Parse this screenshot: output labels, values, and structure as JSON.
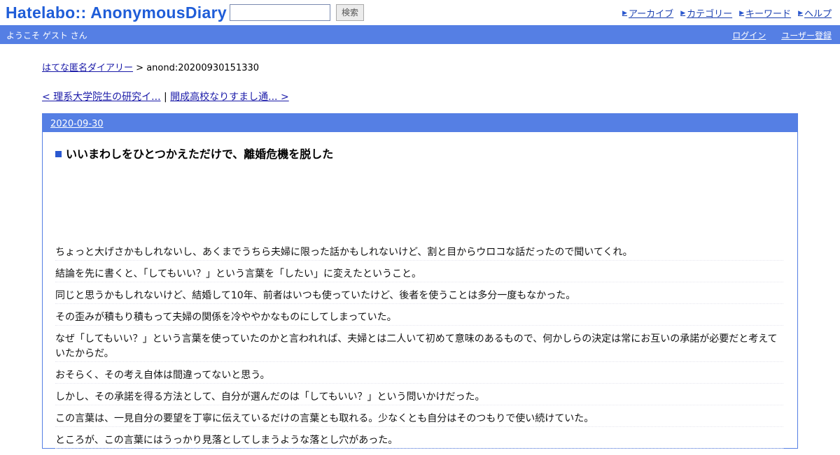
{
  "header": {
    "logo": "Hatelabo:: AnonymousDiary",
    "search_placeholder": "",
    "search_button": "検索",
    "nav": [
      {
        "label": "アーカイブ"
      },
      {
        "label": "カテゴリー"
      },
      {
        "label": "キーワード"
      },
      {
        "label": "ヘルプ"
      }
    ]
  },
  "bluebar": {
    "welcome": "ようこそ ゲスト さん",
    "login": "ログイン",
    "register": "ユーザー登録"
  },
  "breadcrumb": {
    "root": "はてな匿名ダイアリー",
    "separator": ">",
    "current": "anond:20200930151330"
  },
  "pager": {
    "prev": "< 理系大学院生の研究イ...",
    "separator": "|",
    "next": "開成高校なりすまし通... >"
  },
  "day": {
    "date": "2020-09-30",
    "title_marker": "■",
    "title": "いいまわしをひとつかえただけで、離婚危機を脱した",
    "paragraphs": [
      "ちょっと大げさかもしれないし、あくまでうちら夫婦に限った話かもしれないけど、割と目からウロコな話だったので聞いてくれ。",
      "結論を先に書くと、「してもいい？」という言葉を「したい」に変えたということ。",
      "同じと思うかもしれないけど、結婚して10年、前者はいつも使っていたけど、後者を使うことは多分一度もなかった。",
      "その歪みが積もり積もって夫婦の関係を冷ややかなものにしてしまっていた。",
      "なぜ「してもいい？」という言葉を使っていたのかと言われれば、夫婦とは二人いて初めて意味のあるもので、何かしらの決定は常にお互いの承諾が必要だと考えていたからだ。",
      "おそらく、その考え自体は間違ってないと思う。",
      "しかし、その承諾を得る方法として、自分が選んだのは「してもいい？」という問いかけだった。",
      "この言葉は、一見自分の要望を丁寧に伝えているだけの言葉とも取れる。少なくとも自分はそのつもりで使い続けていた。",
      "ところが、この言葉にはうっかり見落としてしまうような落とし穴があった。"
    ]
  }
}
